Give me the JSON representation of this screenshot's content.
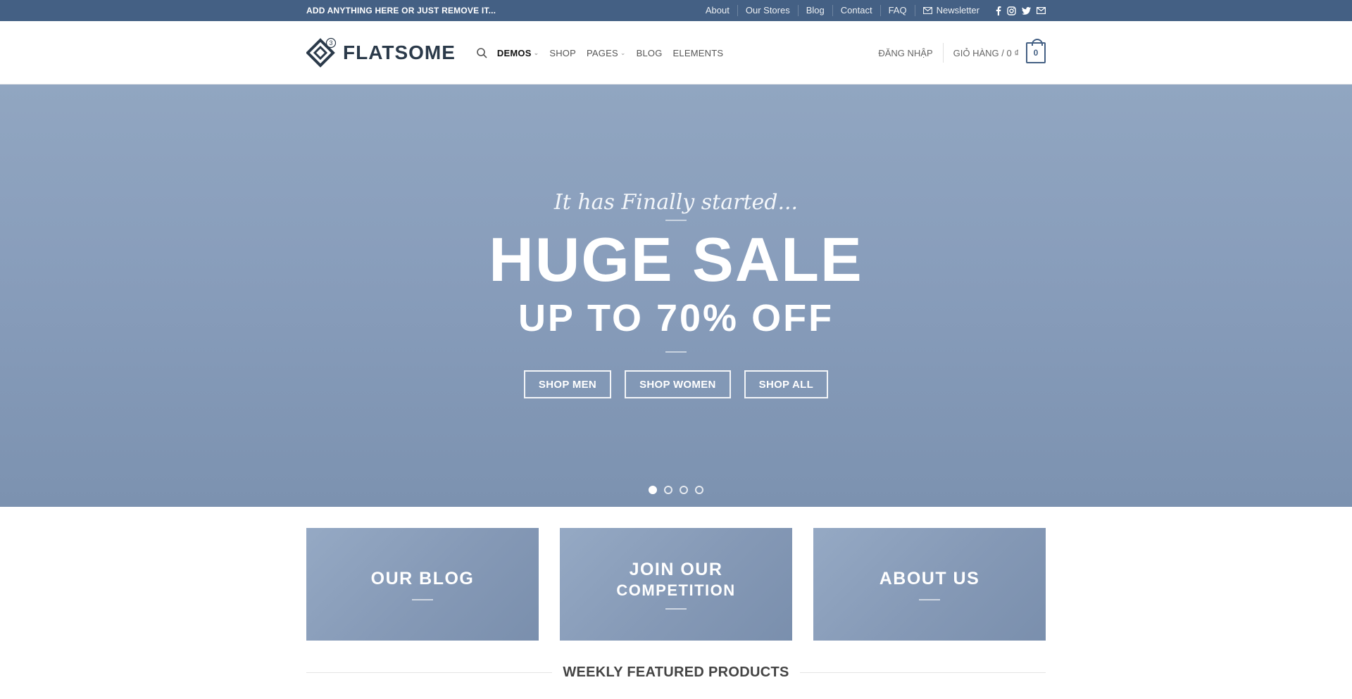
{
  "topbar": {
    "promo": "ADD ANYTHING HERE OR JUST REMOVE IT...",
    "links": [
      "About",
      "Our Stores",
      "Blog",
      "Contact",
      "FAQ"
    ],
    "newsletter": "Newsletter",
    "socials": [
      "facebook-icon",
      "instagram-icon",
      "twitter-icon",
      "email-icon"
    ]
  },
  "header": {
    "logo": "FLATSOME",
    "logo_badge": "3",
    "nav": {
      "demos": "DEMOS",
      "shop": "SHOP",
      "pages": "PAGES",
      "blog": "BLOG",
      "elements": "ELEMENTS"
    },
    "login": "ĐĂNG NHẬP",
    "cart_label": "GIỎ HÀNG / 0 ₫",
    "cart_count": "0"
  },
  "hero": {
    "tagline": "It has Finally started...",
    "title": "HUGE SALE",
    "subtitle": "UP TO 70% OFF",
    "buttons": {
      "men": "SHOP MEN",
      "women": "SHOP WOMEN",
      "all": "SHOP ALL"
    },
    "slide_count": 4,
    "active_slide": 1
  },
  "boxes": {
    "blog": "OUR BLOG",
    "competition_line1": "JOIN OUR",
    "competition_line2": "COMPETITION",
    "about": "ABOUT US"
  },
  "section": {
    "title": "WEEKLY FEATURED PRODUCTS"
  },
  "colors": {
    "primary": "#446084",
    "hero_bg": "#889dbb"
  }
}
